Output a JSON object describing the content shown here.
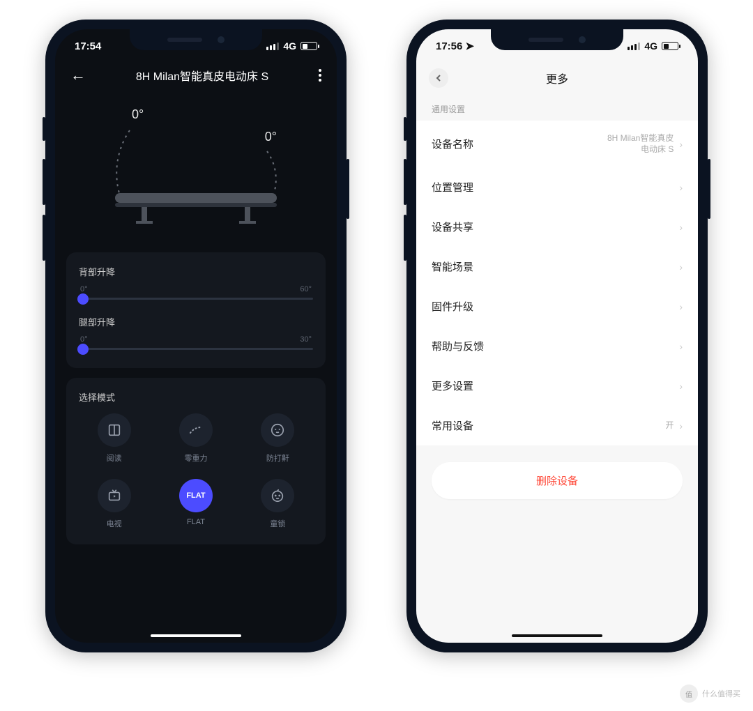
{
  "left": {
    "status": {
      "time": "17:54",
      "network": "4G"
    },
    "title": "8H Milan智能真皮电动床 S",
    "bed": {
      "head_angle": "0°",
      "leg_angle": "0°"
    },
    "sliders": {
      "back": {
        "label": "背部升降",
        "min": "0°",
        "max": "60°"
      },
      "leg": {
        "label": "腿部升降",
        "min": "0°",
        "max": "30°"
      }
    },
    "modes": {
      "header": "选择模式",
      "items": [
        {
          "label": "阅读"
        },
        {
          "label": "零重力"
        },
        {
          "label": "防打鼾"
        },
        {
          "label": "电视"
        },
        {
          "label": "FLAT"
        },
        {
          "label": "童锁"
        }
      ]
    }
  },
  "right": {
    "status": {
      "time": "17:56",
      "network": "4G"
    },
    "title": "更多",
    "section": "通用设置",
    "rows": {
      "name": {
        "label": "设备名称",
        "value": "8H Milan智能真皮\n电动床 S"
      },
      "location": {
        "label": "位置管理"
      },
      "share": {
        "label": "设备共享"
      },
      "scene": {
        "label": "智能场景"
      },
      "firmware": {
        "label": "固件升级"
      },
      "help": {
        "label": "帮助与反馈"
      },
      "more": {
        "label": "更多设置"
      },
      "common": {
        "label": "常用设备",
        "value": "开"
      }
    },
    "delete": "删除设备"
  },
  "watermark": "什么值得买"
}
